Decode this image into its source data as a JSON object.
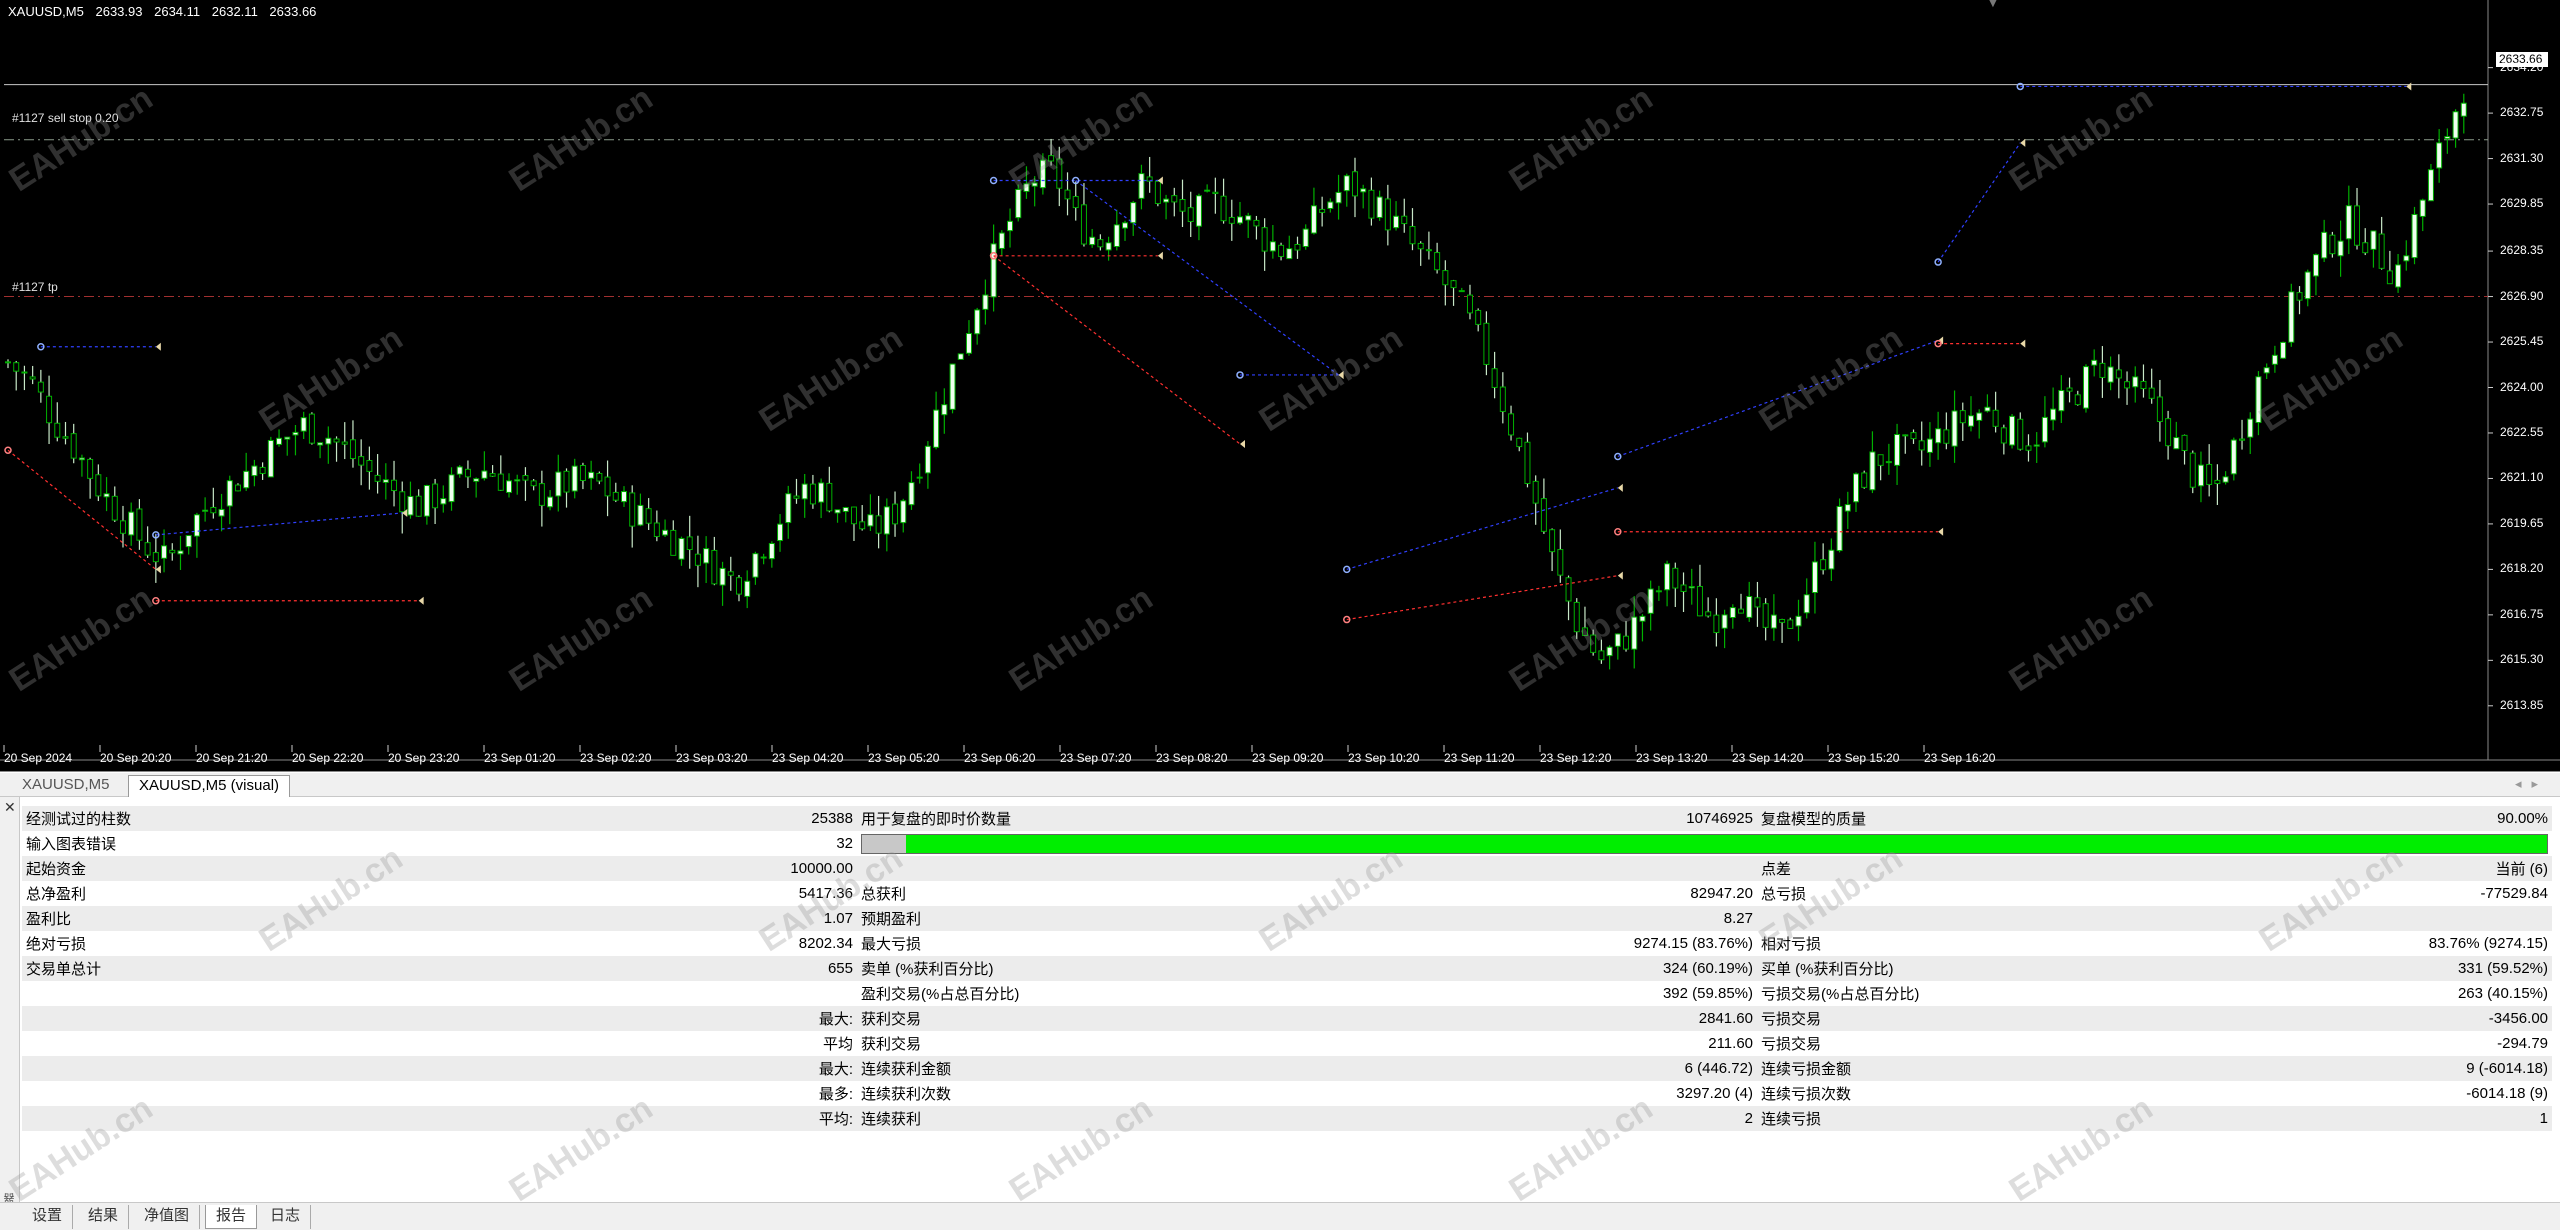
{
  "chart": {
    "symbol_header": "XAUUSD,M5",
    "ohlc": [
      "2633.93",
      "2634.11",
      "2632.11",
      "2633.66"
    ],
    "current_price": "2633.66",
    "labels": {
      "sell_stop": "#1127 sell stop 0.20",
      "tp": "#1127 tp"
    },
    "price_axis": [
      "2634.20",
      "2632.75",
      "2631.30",
      "2629.85",
      "2628.35",
      "2626.90",
      "2625.45",
      "2624.00",
      "2622.55",
      "2621.10",
      "2619.65",
      "2618.20",
      "2616.75",
      "2615.30",
      "2613.85"
    ],
    "time_axis": [
      "20 Sep 2024",
      "20 Sep 20:20",
      "20 Sep 21:20",
      "20 Sep 22:20",
      "20 Sep 23:20",
      "23 Sep 01:20",
      "23 Sep 02:20",
      "23 Sep 03:20",
      "23 Sep 04:20",
      "23 Sep 05:20",
      "23 Sep 06:20",
      "23 Sep 07:20",
      "23 Sep 08:20",
      "23 Sep 09:20",
      "23 Sep 10:20",
      "23 Sep 11:20",
      "23 Sep 12:20",
      "23 Sep 13:20",
      "23 Sep 14:20",
      "23 Sep 15:20",
      "23 Sep 16:20"
    ],
    "price_range": [
      2612.6,
      2635.4
    ],
    "close_path": [
      2624.8,
      2624.2,
      2623.0,
      2622.0,
      2620.8,
      2619.9,
      2619.0,
      2618.4,
      2619.6,
      2620.4,
      2621.0,
      2621.6,
      2622.3,
      2622.8,
      2622.5,
      2621.9,
      2621.2,
      2620.7,
      2620.2,
      2620.6,
      2621.1,
      2621.4,
      2621.0,
      2620.5,
      2620.8,
      2621.0,
      2620.9,
      2620.3,
      2619.8,
      2619.3,
      2618.9,
      2618.3,
      2617.8,
      2618.8,
      2619.9,
      2620.8,
      2620.6,
      2619.8,
      2619.4,
      2620.0,
      2621.5,
      2623.5,
      2625.5,
      2627.5,
      2629.2,
      2630.6,
      2630.9,
      2629.3,
      2628.6,
      2629.6,
      2630.6,
      2629.8,
      2629.4,
      2629.9,
      2629.6,
      2628.9,
      2628.4,
      2628.8,
      2629.9,
      2630.5,
      2629.9,
      2629.2,
      2628.3,
      2627.5,
      2626.5,
      2625.0,
      2623.0,
      2620.8,
      2618.3,
      2616.5,
      2615.3,
      2615.9,
      2616.9,
      2618.0,
      2617.3,
      2616.6,
      2617.6,
      2616.4,
      2616.1,
      2617.4,
      2618.9,
      2620.5,
      2621.6,
      2622.0,
      2621.9,
      2622.5,
      2623.0,
      2623.3,
      2622.6,
      2622.3,
      2623.2,
      2623.9,
      2624.8,
      2624.1,
      2623.6,
      2622.6,
      2621.3,
      2620.6,
      2622.3,
      2624.3,
      2625.9,
      2627.4,
      2628.6,
      2629.3,
      2628.5,
      2627.6,
      2629.6,
      2631.6,
      2633.6
    ],
    "h_lines": [
      {
        "price": 2633.66,
        "color": "#c8c8c8",
        "style": "solid"
      },
      {
        "price": 2631.9,
        "color": "#8a9a8a",
        "style": "dashdot"
      },
      {
        "price": 2626.9,
        "color": "#a03030",
        "style": "dashdot"
      }
    ],
    "colors": {
      "bull": "#00b000",
      "bear": "#ffffff",
      "body": "#f0fff0",
      "buy_line": "#3040ff",
      "sell_line": "#ff3030",
      "arrow_blue": "#8fb0ff",
      "arrow_red": "#ff8080"
    }
  },
  "tabs": {
    "chart_tabs": [
      "XAUUSD,M5",
      "XAUUSD,M5 (visual)"
    ],
    "nav": [
      "◂",
      "▸"
    ],
    "bottom_tabs": [
      "设置",
      "结果",
      "净值图",
      "报告",
      "日志"
    ]
  },
  "report": {
    "rows": [
      {
        "c1": "经测试过的柱数",
        "c2": "25388",
        "c3": "用于复盘的即时价数量",
        "c4": "10746925",
        "c5": "复盘模型的质量",
        "c6": "90.00%"
      },
      {
        "c1": "输入图表错误",
        "c2": "32",
        "progress": 0.974
      },
      {
        "c1": "起始资金",
        "c2": "10000.00",
        "c3": "",
        "c4": "",
        "c5": "点差",
        "c6": "当前 (6)"
      },
      {
        "c1": "总净盈利",
        "c2": "5417.36",
        "c3": "总获利",
        "c4": "82947.20",
        "c5": "总亏损",
        "c6": "-77529.84"
      },
      {
        "c1": "盈利比",
        "c2": "1.07",
        "c3": "预期盈利",
        "c4": "8.27",
        "c5": "",
        "c6": ""
      },
      {
        "c1": "绝对亏损",
        "c2": "8202.34",
        "c3": "最大亏损",
        "c4": "9274.15 (83.76%)",
        "c5": "相对亏损",
        "c6": "83.76% (9274.15)"
      },
      {
        "c1": "交易单总计",
        "c2": "655",
        "c3": "卖单 (%获利百分比)",
        "c4": "324 (60.19%)",
        "c5": "买单 (%获利百分比)",
        "c6": "331 (59.52%)"
      },
      {
        "c1": "",
        "c2": "",
        "c3": "盈利交易(%占总百分比)",
        "c4": "392 (59.85%)",
        "c5": "亏损交易(%占总百分比)",
        "c6": "263 (40.15%)"
      },
      {
        "c1": "",
        "c2": "最大:",
        "c3": "获利交易",
        "c4": "2841.60",
        "c5": "亏损交易",
        "c6": "-3456.00"
      },
      {
        "c1": "",
        "c2": "平均",
        "c3": "获利交易",
        "c4": "211.60",
        "c5": "亏损交易",
        "c6": "-294.79"
      },
      {
        "c1": "",
        "c2": "最大:",
        "c3": "连续获利金额",
        "c4": "6 (446.72)",
        "c5": "连续亏损金额",
        "c6": "9 (-6014.18)"
      },
      {
        "c1": "",
        "c2": "最多:",
        "c3": "连续获利次数",
        "c4": "3297.20 (4)",
        "c5": "连续亏损次数",
        "c6": "-6014.18 (9)"
      },
      {
        "c1": "",
        "c2": "平均:",
        "c3": "连续获利",
        "c4": "2",
        "c5": "连续亏损",
        "c6": "1"
      }
    ]
  },
  "watermark": "EAHub.cn",
  "strip": {
    "close": "✕",
    "label": "测试器"
  }
}
